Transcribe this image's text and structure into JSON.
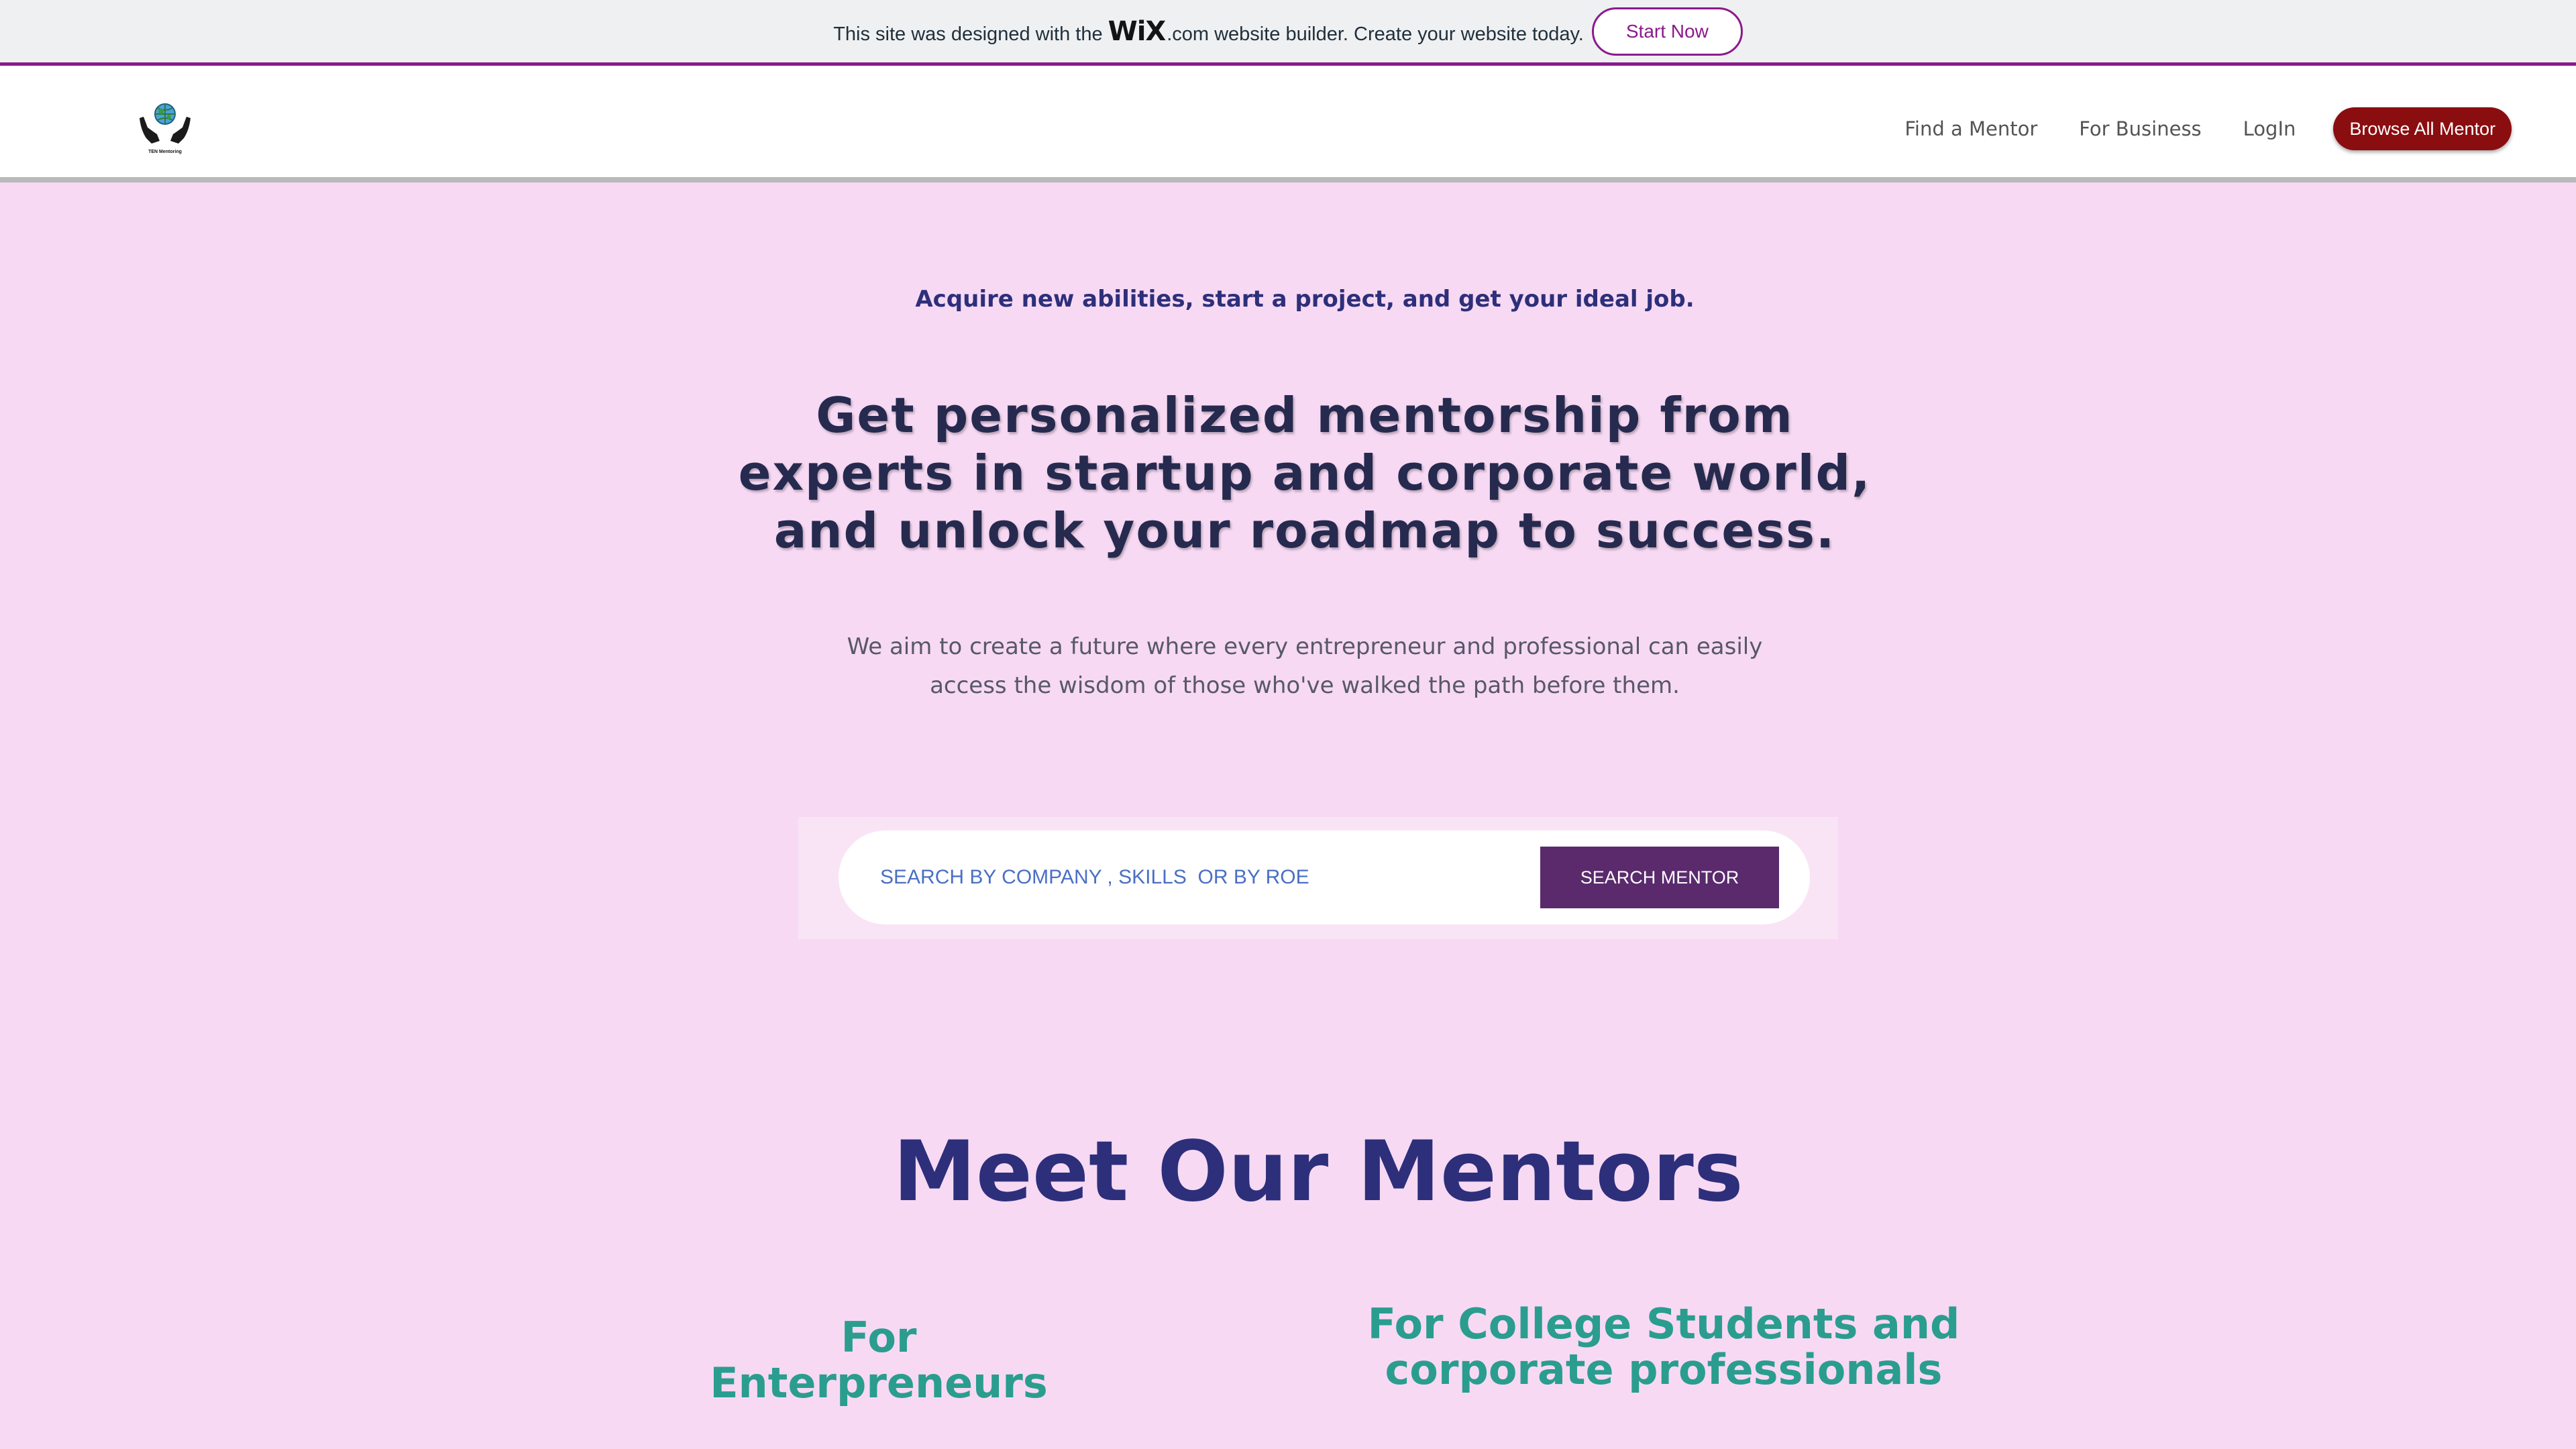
{
  "wix_banner": {
    "text_before": "This site was designed with the",
    "wix_logo": "WiX",
    "wix_suffix": ".com",
    "text_after": "website builder. Create your website today.",
    "start_label": "Start Now"
  },
  "header": {
    "logo_caption": "TEN Mentoring",
    "nav": {
      "find_mentor": "Find a Mentor",
      "for_business": "For Business",
      "login": "LogIn",
      "browse_all": "Browse All Mentor"
    }
  },
  "hero": {
    "tagline": "Acquire new abilities, start a project, and get your ideal job.",
    "headline": "Get personalized mentorship from experts in startup and corporate world, and unlock your roadmap to success.",
    "subtext": "We aim to create a future where every entrepreneur and professional can easily access the wisdom of those who've walked the path before them."
  },
  "search": {
    "placeholder": "SEARCH BY COMPANY , SKILLS  OR BY ROE",
    "button_label": "SEARCH MENTOR"
  },
  "mentors": {
    "title": "Meet Our Mentors",
    "left_heading": "For Enterpreneurs",
    "right_heading": "For College Students and corporate professionals"
  },
  "colors": {
    "page_bg": "#f7d9f4",
    "brand_purple": "#8b1a8b",
    "browse_red": "#8a0d10",
    "search_button": "#5a2a6d",
    "heading_navy": "#2d2f7a",
    "teal": "#2a9d8f"
  },
  "icons": {
    "logo": "hands-holding-globe-icon"
  }
}
